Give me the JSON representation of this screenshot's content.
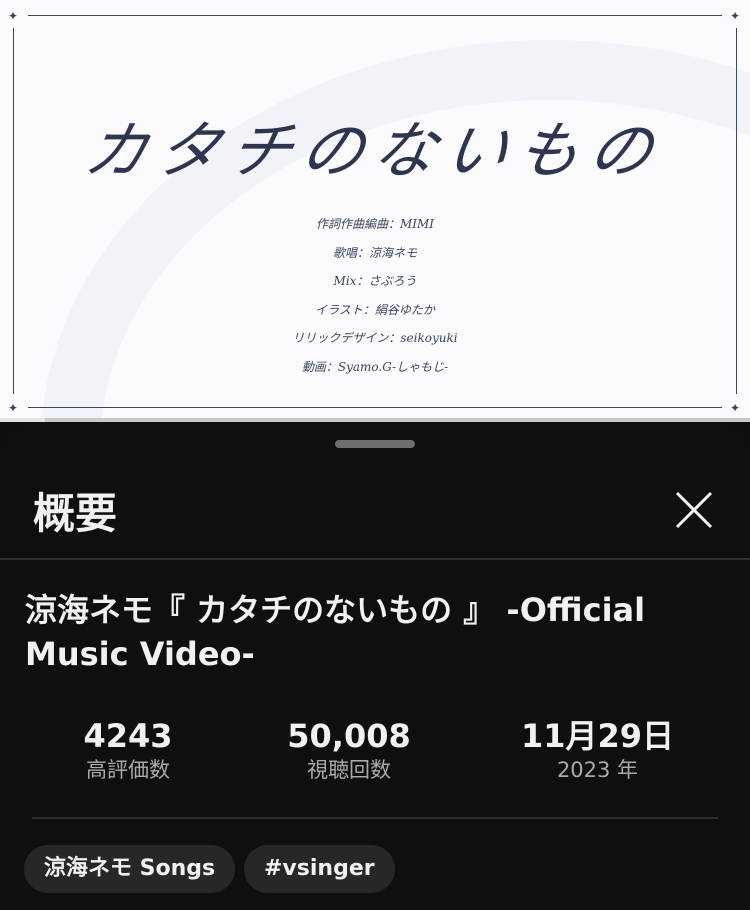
{
  "video": {
    "title_art": "カタチのないもの",
    "credits": [
      "作詞作曲編曲：MIMI",
      "歌唱：涼海ネモ",
      "Mix：さぶろう",
      "イラスト：絹谷ゆたか",
      "リリックデザイン：seikoyuki",
      "動画：Syamo.G-しゃもじ-"
    ],
    "progress_fraction": 0.06
  },
  "sheet": {
    "title": "概要",
    "close_icon": "close-icon",
    "video_title": "涼海ネモ『 カタチのないもの 』 -Official Music Video-",
    "stats": [
      {
        "value": "4243",
        "label": "高評価数"
      },
      {
        "value": "50,008",
        "label": "視聴回数"
      },
      {
        "value": "11月29日",
        "label": "2023 年"
      }
    ],
    "tags": [
      "涼海ネモ Songs",
      "#vsinger"
    ]
  },
  "colors": {
    "background": "#0f0f0f",
    "text_primary": "#f1f1f1",
    "text_secondary": "#aaaaaa",
    "chip_bg": "#272727",
    "frame_ink": "#3b4560"
  }
}
